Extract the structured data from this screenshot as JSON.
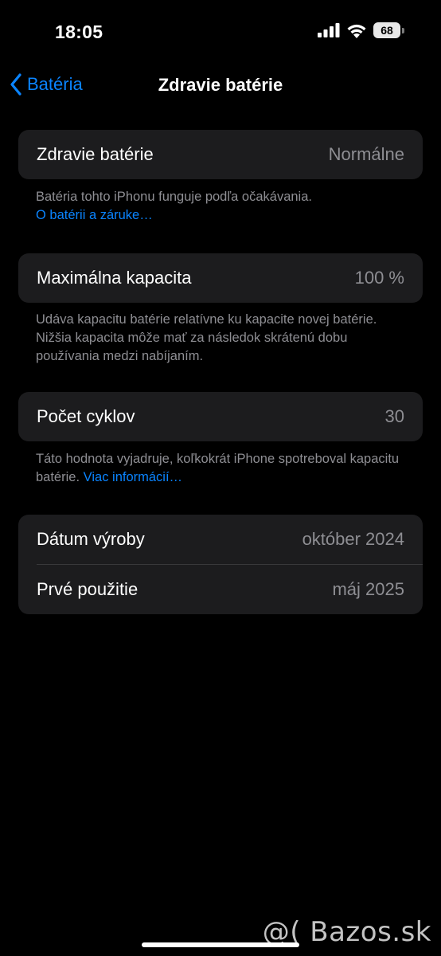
{
  "status": {
    "time": "18:05",
    "battery": "68"
  },
  "nav": {
    "back_label": "Batéria",
    "title": "Zdravie batérie"
  },
  "health": {
    "label": "Zdravie batérie",
    "value": "Normálne",
    "footnote": "Batéria tohto iPhonu funguje podľa očakávania.",
    "link": "O batérii a záruke…"
  },
  "capacity": {
    "label": "Maximálna kapacita",
    "value": "100 %",
    "footnote": "Udáva kapacitu batérie relatívne ku kapacite novej batérie. Nižšia kapacita môže mať za následok skrátenú dobu používania medzi nabíjaním."
  },
  "cycles": {
    "label": "Počet cyklov",
    "value": "30",
    "footnote": "Táto hodnota vyjadruje, koľkokrát iPhone spotreboval kapacitu batérie.",
    "link": "Viac informácií…"
  },
  "dates": {
    "manufacture_label": "Dátum výroby",
    "manufacture_value": "október 2024",
    "first_use_label": "Prvé použitie",
    "first_use_value": "máj 2025"
  },
  "watermark": "@( Bazos.sk",
  "colors": {
    "accent": "#0a84ff",
    "background": "#000000",
    "card": "#1c1c1e",
    "secondary_text": "#8e8e93"
  }
}
